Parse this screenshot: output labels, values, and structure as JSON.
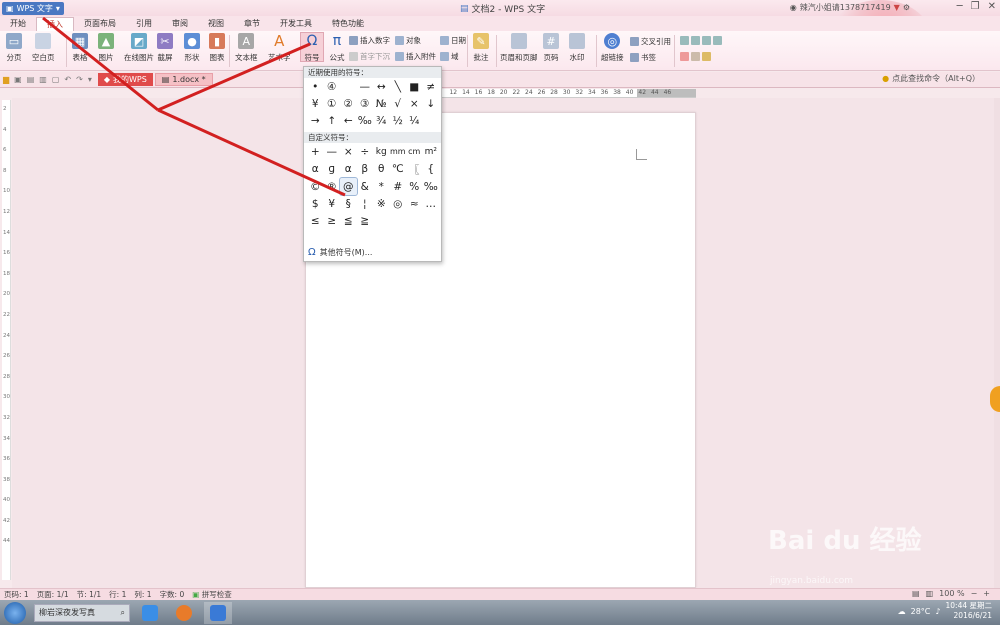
{
  "titlebar": {
    "app_name": "WPS 文字",
    "doc_title": "文档2 - WPS 文字",
    "user": "辣汽小姐请1378717419"
  },
  "menus": [
    "开始",
    "插入",
    "页面布局",
    "引用",
    "审阅",
    "视图",
    "章节",
    "开发工具",
    "特色功能"
  ],
  "ribbon": {
    "page": "分页",
    "blank_page": "空白页",
    "table": "表格",
    "picture": "图片",
    "online_picture": "在线图片",
    "screenshot": "截屏",
    "shape": "形状",
    "chart": "图表",
    "textbox": "文本框",
    "art_text": "艺术字",
    "symbol": "符号",
    "formula": "公式",
    "insert_number": "插入数字",
    "first_letter": "首字下沉",
    "object": "对象",
    "attachment": "插入附件",
    "date": "日期",
    "field": "域",
    "comment": "批注",
    "header_footer": "页眉和页脚",
    "page_number": "页码",
    "watermark": "水印",
    "hyperlink": "超链接",
    "cross_ref": "交叉引用",
    "bookmark": "书签"
  },
  "tabs": {
    "wps": "我的WPS",
    "doc": "1.docx *",
    "search": "点此查找命令（Alt+Q）"
  },
  "ruler": {
    "h_ticks": [
      "12",
      "14",
      "16",
      "18",
      "20",
      "22",
      "24",
      "26",
      "28",
      "30",
      "32",
      "34",
      "36",
      "38",
      "40",
      "42",
      "44",
      "46"
    ],
    "v_ticks": [
      "2",
      "4",
      "6",
      "8",
      "10",
      "12",
      "14",
      "16",
      "18",
      "20",
      "22",
      "24",
      "26",
      "28",
      "30",
      "32",
      "34",
      "36",
      "38",
      "40",
      "42",
      "44"
    ]
  },
  "symbols": {
    "recent_header": "近期使用的符号：",
    "recent": [
      "•",
      "④",
      " ",
      "—",
      "↔",
      "╲",
      "■",
      "≠",
      "¥",
      "①",
      "②",
      "③",
      "№",
      "√",
      "×",
      "↓",
      "→",
      "↑",
      "←",
      "‰",
      "¾",
      "½",
      "¼"
    ],
    "custom_header": "自定义符号：",
    "custom": [
      "+",
      "—",
      "×",
      "÷",
      "kg",
      "mm",
      "cm",
      "m²",
      "α",
      "ɡ",
      "α",
      "β",
      "θ",
      "℃",
      "〖",
      "{",
      "©",
      "®",
      "@",
      "&",
      "*",
      "#",
      "%",
      "‰",
      "$",
      "¥",
      "§",
      "¦",
      "※",
      "◎",
      "≈",
      "…",
      "≤",
      "≥",
      "≦",
      "≧"
    ],
    "more": "其他符号(M)..."
  },
  "status": {
    "page_num": "页码: 1",
    "pages": "页面: 1/1",
    "section": "节: 1/1",
    "row": "行: 1",
    "col": "列: 1",
    "words": "字数: 0",
    "spell": "拼写检查",
    "zoom": "100 %"
  },
  "taskbar": {
    "search": "柳岩深夜发写真",
    "temp": "28°C",
    "time": "10:44 星期二",
    "date": "2016/6/21"
  },
  "watermark": {
    "text": "Bai du 经验",
    "sub": "jingyan.baidu.com"
  },
  "colors": {
    "accent": "#c0392b",
    "annotation": "#d22020",
    "ribbon_bg": "#fbe8ee"
  }
}
